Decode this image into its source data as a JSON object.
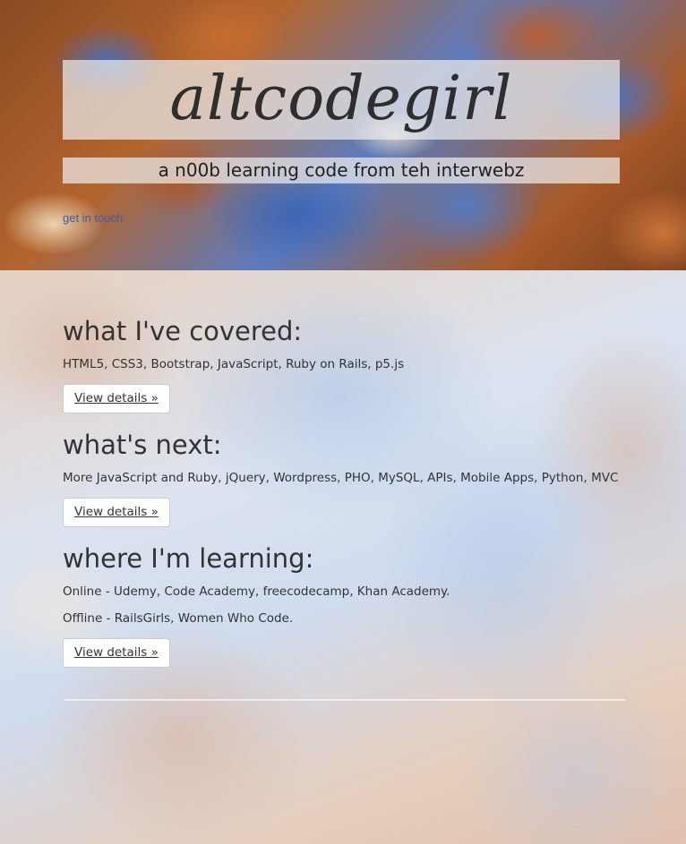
{
  "header": {
    "site_title": "altcodegirl",
    "tagline": "a n00b learning code from teh interwebz",
    "contact_link": "get in touch"
  },
  "sections": [
    {
      "heading": "what I've covered:",
      "lines": [
        "HTML5, CSS3, Bootstrap, JavaScript, Ruby on Rails, p5.js"
      ],
      "button": "View details »"
    },
    {
      "heading": "what's next:",
      "lines": [
        "More JavaScript and Ruby, jQuery, Wordpress, PHO, MySQL, APIs, Mobile Apps, Python, MVC"
      ],
      "button": "View details »"
    },
    {
      "heading": "where I'm learning:",
      "lines": [
        "Online - Udemy, Code Academy, freecodecamp, Khan Academy.",
        "Offline - RailsGirls, Women Who Code."
      ],
      "button": "View details »"
    }
  ],
  "colors": {
    "link": "#3a5fa8",
    "text": "#333333",
    "button_bg": "#ffffff",
    "button_border": "#cccccc"
  }
}
